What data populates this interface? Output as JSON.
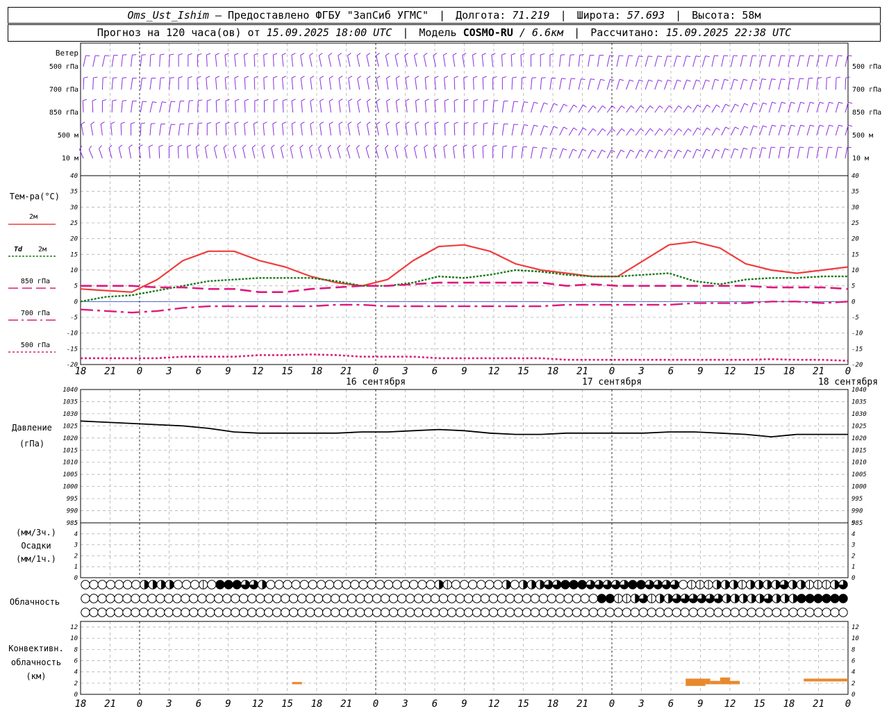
{
  "header": {
    "station": "Oms_Ust_Ishim",
    "dash": "–",
    "provider": "Предоставлено ФГБУ \"ЗапСиб УГМС\"",
    "lon_label": "Долгота:",
    "lon_value": "71.219",
    "lat_label": "Широта:",
    "lat_value": "57.693",
    "alt_label": "Высота:",
    "alt_value": "58м",
    "forecast_label": "Прогноз на 120 часа(ов) от",
    "forecast_start": "15.09.2025 18:00 UTC",
    "model_label": "Модель",
    "model_name": "COSMO-RU",
    "model_res": "/ 6.6км",
    "computed_label": "Рассчитано:",
    "computed_value": "15.09.2025 22:38 UTC"
  },
  "labels": {
    "wind": "Ветер",
    "wind_levels": [
      "500 гПа",
      "700 гПа",
      "850 гПа",
      "500 м",
      "10   м"
    ],
    "temp_title": "Тем-ра(°С)",
    "t2m": "2м",
    "td": "Td",
    "td2m": "2м",
    "t850": "850 гПа",
    "t700": "700 гПа",
    "t500": "500 гПа",
    "pressure_title": "Давление",
    "pressure_unit": "(гПа)",
    "precip_unit3": "(мм/3ч.)",
    "precip_title": "Осадки",
    "precip_unit1": "(мм/1ч.)",
    "cloud_title": "Облачность",
    "conv_title1": "Конвективн.",
    "conv_title2": "облачность",
    "conv_unit": "(км)"
  },
  "colors": {
    "t2m": "#f03c3c",
    "td2m": "#1a7a1a",
    "t850": "#dd1a7a",
    "t700": "#dd1a7a",
    "t500": "#dd1a7a",
    "pressure": "#000000",
    "wind": "#8a2be2",
    "convective": "#e8892e",
    "grid": "#b0b0b0"
  },
  "chart_data": [
    {
      "type": "line",
      "name": "temperature",
      "x_ticks": [
        "18",
        "21",
        "0",
        "3",
        "6",
        "9",
        "12",
        "15",
        "18",
        "21",
        "0",
        "3",
        "6",
        "9",
        "12",
        "15",
        "18",
        "21",
        "0",
        "3",
        "6",
        "9",
        "12",
        "15",
        "18",
        "21",
        "0"
      ],
      "day_labels": [
        "16 сентября",
        "17 сентября",
        "18 сентября"
      ],
      "ylim": [
        -20,
        40
      ],
      "y_ticks": [
        -20,
        -15,
        -10,
        -5,
        0,
        5,
        10,
        15,
        20,
        25,
        30,
        35,
        40
      ],
      "hours": [
        0,
        3,
        6,
        9,
        12,
        15,
        18,
        21,
        24,
        27,
        30,
        33,
        36,
        39,
        42,
        45,
        48,
        51,
        54,
        57,
        60,
        63,
        66,
        69,
        72,
        75,
        78
      ],
      "series": [
        {
          "key": "t2m",
          "values": [
            4,
            3.5,
            3,
            7,
            13,
            16,
            16,
            13,
            11,
            8,
            6,
            5,
            7,
            13,
            17.5,
            18,
            16,
            12,
            10,
            9,
            8,
            8,
            13,
            18,
            19,
            17,
            12,
            10,
            9,
            10,
            11
          ]
        },
        {
          "key": "td2m",
          "values": [
            0,
            1.5,
            2,
            3.5,
            5,
            6.5,
            7,
            7.5,
            7.5,
            7.5,
            6.5,
            5,
            5,
            6,
            8,
            7.5,
            8.5,
            10,
            9.5,
            8.5,
            8,
            8,
            8.5,
            9,
            6.5,
            5.5,
            7,
            7.5,
            7.5,
            8,
            8
          ]
        },
        {
          "key": "t850",
          "values": [
            5,
            5,
            5,
            4.5,
            4.5,
            4,
            4,
            3,
            3,
            4,
            4.5,
            5,
            5,
            5.5,
            6,
            6,
            6,
            6,
            6,
            5,
            5.5,
            5,
            5,
            5,
            5,
            5,
            5,
            4.5,
            4.5,
            4.5,
            4
          ]
        },
        {
          "key": "t700",
          "values": [
            -2.5,
            -3,
            -3.5,
            -3,
            -2,
            -1.5,
            -1.5,
            -1.5,
            -1.5,
            -1.5,
            -1,
            -1,
            -1.5,
            -1.5,
            -1.5,
            -1.5,
            -1.5,
            -1.5,
            -1.5,
            -1,
            -1,
            -1,
            -1,
            -1,
            -0.5,
            -0.5,
            -0.5,
            0,
            0,
            -0.5,
            0
          ]
        },
        {
          "key": "t500",
          "values": [
            -18,
            -18,
            -18,
            -18,
            -17.5,
            -17.5,
            -17.5,
            -17,
            -17,
            -16.8,
            -17,
            -17.5,
            -17.5,
            -17.5,
            -18,
            -18,
            -18,
            -18,
            -18,
            -18.5,
            -18.5,
            -18.5,
            -18.5,
            -18.5,
            -18.5,
            -18.5,
            -18.5,
            -18.3,
            -18.5,
            -18.5,
            -18.8
          ]
        }
      ]
    },
    {
      "type": "line",
      "name": "pressure",
      "ylim": [
        985,
        1040
      ],
      "y_ticks": [
        985,
        990,
        995,
        1000,
        1005,
        1010,
        1015,
        1020,
        1025,
        1030,
        1035,
        1040
      ],
      "values": [
        1027,
        1026.5,
        1026,
        1025.5,
        1025,
        1024,
        1022.5,
        1022,
        1022,
        1022,
        1022,
        1022.5,
        1022.5,
        1023,
        1023.5,
        1023,
        1022,
        1021.5,
        1021.5,
        1022,
        1022,
        1022,
        1022,
        1022.5,
        1022.5,
        1022,
        1021.5,
        1020.5,
        1021.5,
        1021.5,
        1021.5
      ]
    },
    {
      "type": "bar",
      "name": "precipitation",
      "ylim": [
        0,
        5
      ],
      "y_ticks": [
        0,
        1,
        2,
        3,
        4,
        5
      ],
      "values": []
    },
    {
      "type": "table",
      "name": "cloudiness",
      "rows": [
        "upper",
        "middle",
        "lower"
      ],
      "legend_scale": "0 = clear, 4 = overcast",
      "upper": [
        0,
        0,
        0,
        0,
        0,
        0,
        0,
        2,
        2,
        2,
        2,
        0,
        0,
        0,
        1,
        0,
        4,
        4,
        4,
        3,
        3,
        2,
        0,
        0,
        0,
        0,
        0,
        0,
        0,
        0,
        0,
        0,
        0,
        0,
        0,
        0,
        0,
        0,
        0,
        0,
        0,
        0,
        2,
        1,
        0,
        0,
        0,
        0,
        0,
        0,
        2,
        0,
        2,
        2,
        2,
        3,
        3,
        4,
        4,
        4,
        3,
        3,
        3,
        3,
        3,
        4,
        4,
        3,
        3,
        3,
        3,
        0,
        1,
        1,
        1,
        2,
        2,
        2,
        1,
        2,
        2,
        2,
        2,
        3,
        2,
        2,
        1,
        1,
        1,
        2,
        3
      ],
      "middle": [
        0,
        0,
        0,
        0,
        0,
        0,
        0,
        0,
        0,
        0,
        0,
        0,
        0,
        0,
        0,
        0,
        0,
        0,
        0,
        0,
        0,
        0,
        0,
        0,
        0,
        0,
        0,
        0,
        0,
        0,
        0,
        0,
        0,
        0,
        0,
        0,
        0,
        0,
        0,
        0,
        0,
        0,
        0,
        0,
        0,
        0,
        0,
        0,
        0,
        0,
        0,
        0,
        0,
        0,
        0,
        0,
        0,
        0,
        0,
        0,
        0,
        0,
        4,
        4,
        1,
        1,
        2,
        3,
        1,
        2,
        2,
        3,
        3,
        3,
        3,
        3,
        3,
        2,
        2,
        2,
        2,
        2,
        3,
        2,
        2,
        2,
        4,
        4,
        4,
        4,
        4,
        4
      ],
      "lower": [
        0,
        0,
        0,
        0,
        0,
        0,
        0,
        0,
        0,
        0,
        0,
        0,
        0,
        0,
        0,
        0,
        0,
        0,
        0,
        0,
        0,
        0,
        0,
        0,
        0,
        0,
        0,
        0,
        0,
        0,
        0,
        0,
        0,
        0,
        0,
        0,
        0,
        0,
        0,
        0,
        0,
        0,
        0,
        0,
        0,
        0,
        0,
        0,
        0,
        0,
        0,
        0,
        0,
        0,
        0,
        0,
        0,
        0,
        0,
        0,
        0,
        0,
        0,
        0,
        0,
        0,
        0,
        0,
        0,
        0,
        0,
        0,
        0,
        0,
        0,
        0,
        0,
        0,
        0,
        0,
        0,
        0,
        0,
        0,
        0,
        0,
        0,
        0,
        0,
        0,
        0,
        0
      ]
    },
    {
      "type": "bar",
      "name": "convective_cloud",
      "ylim": [
        0,
        13
      ],
      "y_ticks": [
        0,
        2,
        4,
        6,
        8,
        10,
        12
      ],
      "segments": [
        {
          "h0": 21.5,
          "h1": 22.5,
          "base": 1.8,
          "top": 2.2
        },
        {
          "h0": 61.5,
          "h1": 63.5,
          "base": 1.5,
          "top": 2.8
        },
        {
          "h0": 63.5,
          "h1": 64,
          "base": 1.8,
          "top": 2.8
        },
        {
          "h0": 64,
          "h1": 65,
          "base": 1.8,
          "top": 2.4
        },
        {
          "h0": 65,
          "h1": 66,
          "base": 1.8,
          "top": 3.0
        },
        {
          "h0": 66,
          "h1": 67,
          "base": 1.8,
          "top": 2.4
        },
        {
          "h0": 73.5,
          "h1": 78,
          "base": 2.3,
          "top": 2.8
        }
      ]
    }
  ]
}
